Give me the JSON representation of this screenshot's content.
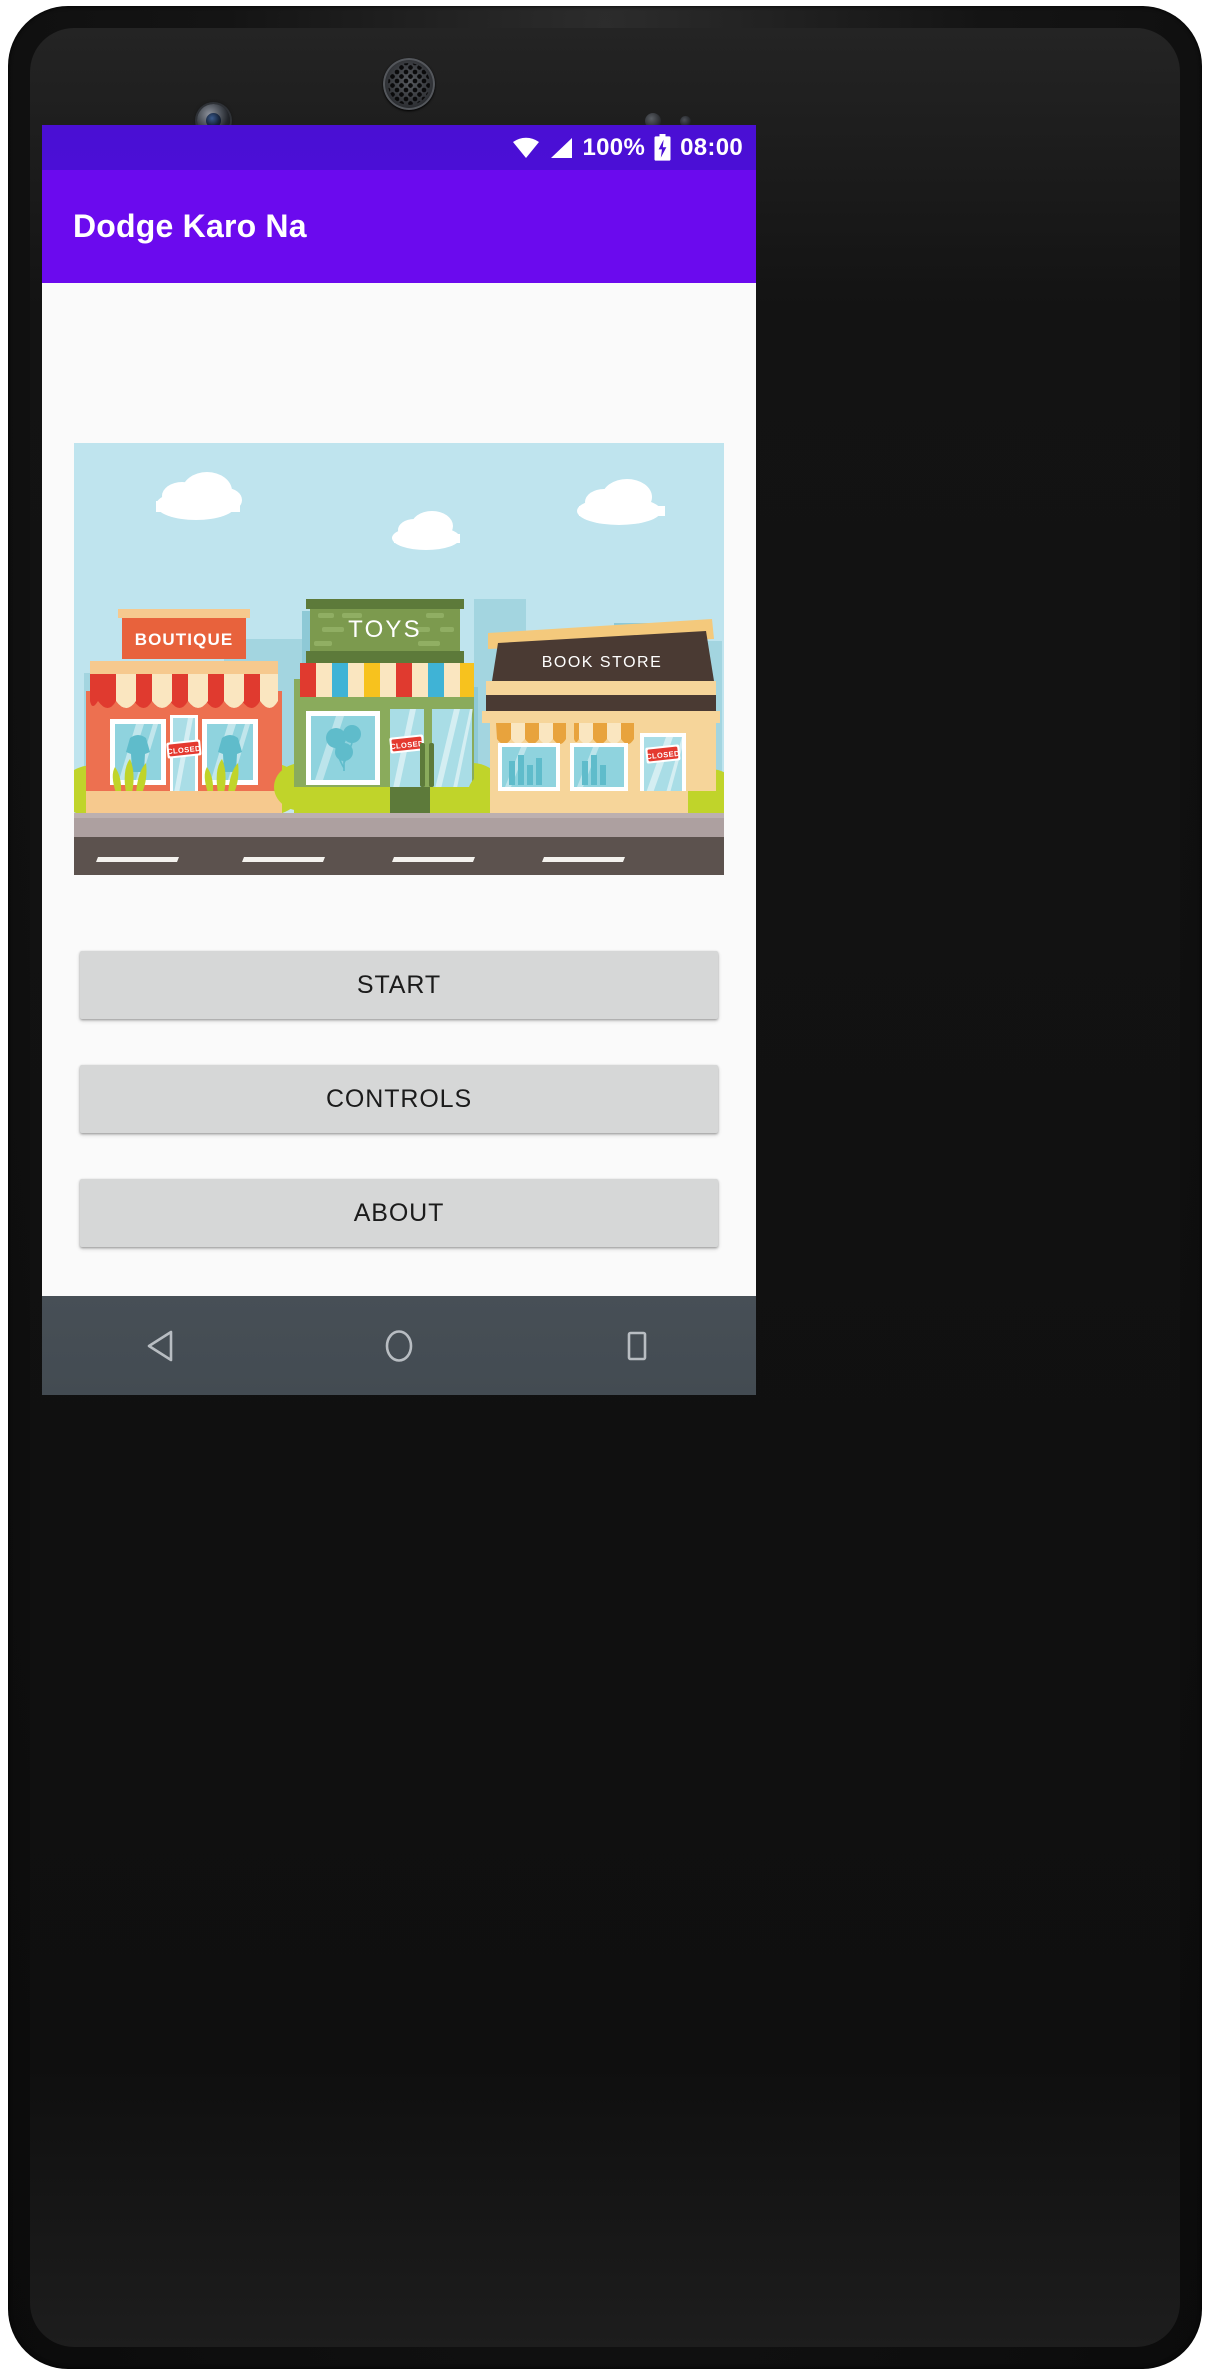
{
  "device": {
    "sensors": {
      "front_camera": "front-camera",
      "earpiece": "earpiece-speaker",
      "proximity": "proximity-sensor",
      "ambient_light": "ambient-light-sensor"
    }
  },
  "status_bar": {
    "background_color": "#4b0fd6",
    "wifi_icon": "wifi-icon",
    "signal_icon": "signal-bars-icon",
    "battery_percent": "100%",
    "battery_icon": "battery-charging-icon",
    "time": "08:00"
  },
  "app_bar": {
    "title": "Dodge Karo Na",
    "background_color": "#6b0aee",
    "text_color": "#ffffff"
  },
  "illustration": {
    "name": "storefront-street-illustration",
    "sky_color": "#bfe4ee",
    "road_color": "#5c524e",
    "sidewalk_color": "#ada0a0",
    "road_dashes": 4,
    "clouds": 3,
    "shops": [
      {
        "name": "boutique-shop",
        "sign_text": "BOUTIQUE",
        "sign_color": "#e8623c",
        "sign_text_color": "#ffffff",
        "awning_colors": [
          "#e03a2f",
          "#fae6c0"
        ],
        "facade_color": "#ed7050",
        "closed_sign": "CLOSED"
      },
      {
        "name": "toys-shop",
        "sign_text": "TOYS",
        "sign_color": "#7c9a4e",
        "sign_text_color": "#ffffff",
        "awning_colors": [
          "#e03a2f",
          "#fae6c0",
          "#3fb3d6",
          "#f7c21e"
        ],
        "facade_color": "#8aab5c",
        "closed_sign": "CLOSED"
      },
      {
        "name": "book-store-shop",
        "sign_text": "BOOK STORE",
        "sign_color": "#4a3a33",
        "sign_text_color": "#ffffff",
        "awning_colors": [
          "#e8a33d",
          "#fae6c0"
        ],
        "facade_color": "#f6d59a",
        "closed_sign": "CLOSED"
      }
    ]
  },
  "menu": {
    "buttons": [
      {
        "label": "START",
        "name": "start-button"
      },
      {
        "label": "CONTROLS",
        "name": "controls-button"
      },
      {
        "label": "ABOUT",
        "name": "about-button"
      }
    ],
    "button_color": "#d6d7d7",
    "button_text_color": "#1b1b1b"
  },
  "nav_bar": {
    "background_color": "#454d54",
    "items": [
      {
        "name": "back-button",
        "icon": "back-triangle-icon"
      },
      {
        "name": "home-button",
        "icon": "home-circle-icon"
      },
      {
        "name": "recents-button",
        "icon": "recents-square-icon"
      }
    ]
  }
}
